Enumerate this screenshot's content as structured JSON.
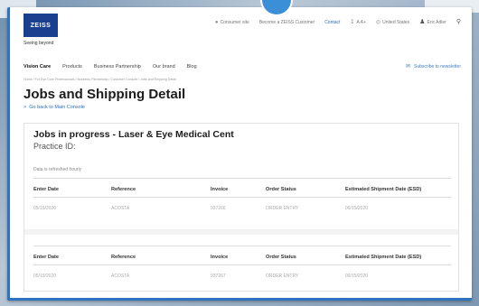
{
  "brand": {
    "logo_text": "ZEISS",
    "tagline": "Seeing beyond"
  },
  "utility_bar": {
    "consumer_site": "Consumer site",
    "become_customer": "Become a ZEISS Customer",
    "contact": "Contact",
    "text_size": "A A+",
    "country": "United States",
    "user_name": "Eric Adler"
  },
  "nav": {
    "items": [
      "Vision Care",
      "Products",
      "Business Partnership",
      "Our brand",
      "Blog"
    ],
    "newsletter": "Subscribe to newsletter"
  },
  "breadcrumb": "Home  /  For Eye Care Professionals  /  Business Partnership  /  Customer Console  /  Jobs and Shipping Detail",
  "page": {
    "title": "Jobs and Shipping Detail",
    "back_link": "Go back to Main Console",
    "back_arrow": ">"
  },
  "jobs": {
    "heading_prefix": "Jobs in progress -",
    "practice_name": "Laser & Eye Medical Cent",
    "practice_label": "Practice ID:",
    "refresh_note": "Data is refreshed hourly",
    "columns": [
      "Enter Date",
      "Reference",
      "Invoice",
      "Order Status",
      "Estimated Shipment Date (ESD)"
    ],
    "rows": [
      [
        "05/19/2020",
        "ACOSTA",
        "937266",
        "ORDER ENTRY",
        "06/15/2020"
      ],
      [
        "05/19/2020",
        "ACOSTA",
        "937267",
        "ORDER ENTRY",
        "06/15/2020"
      ]
    ]
  },
  "colors": {
    "accent_blue": "#2a6ebd",
    "logo_blue": "#1b3f8f"
  }
}
